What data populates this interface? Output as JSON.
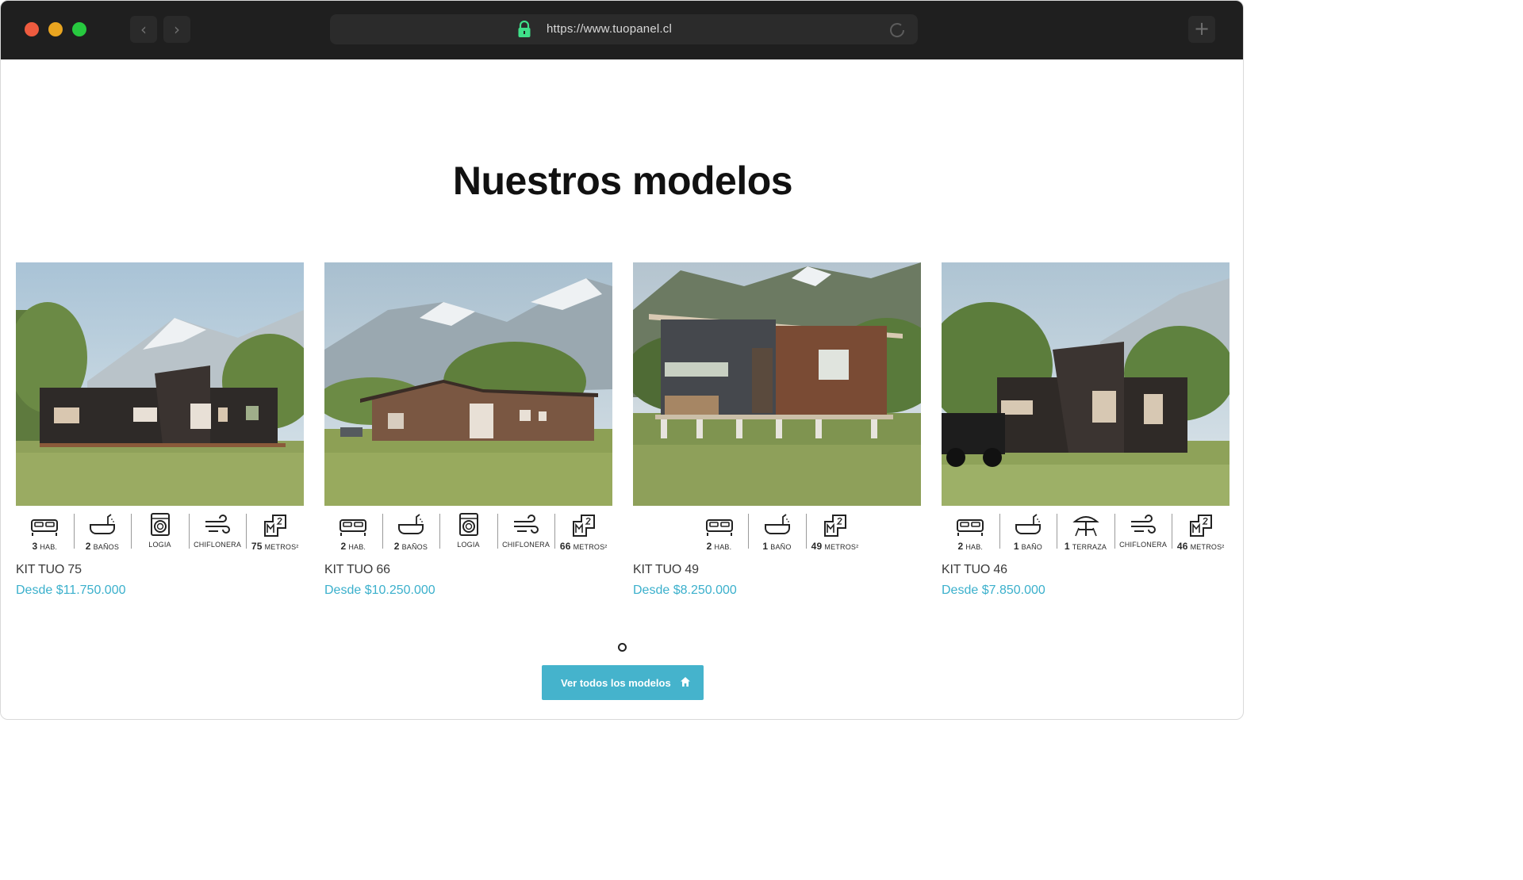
{
  "browser": {
    "url": "https://www.tuopanel.cl",
    "back_glyph": "‹",
    "forward_glyph": "›",
    "new_tab_glyph": "+"
  },
  "section": {
    "title": "Nuestros modelos"
  },
  "models": [
    {
      "name": "KIT TUO 75",
      "price": "Desde $11.750.000",
      "features": [
        {
          "icon": "bed-icon",
          "value": "3",
          "unit": "HAB."
        },
        {
          "icon": "bathtub-icon",
          "value": "2",
          "unit": "BAÑOS"
        },
        {
          "icon": "washing-machine-icon",
          "value": "",
          "unit": "LOGIA"
        },
        {
          "icon": "wind-icon",
          "value": "",
          "unit": "CHIFLONERA"
        },
        {
          "icon": "area-icon",
          "value": "75",
          "unit": "METROS²"
        }
      ]
    },
    {
      "name": "KIT TUO 66",
      "price": "Desde $10.250.000",
      "features": [
        {
          "icon": "bed-icon",
          "value": "2",
          "unit": "HAB."
        },
        {
          "icon": "bathtub-icon",
          "value": "2",
          "unit": "BAÑOS"
        },
        {
          "icon": "washing-machine-icon",
          "value": "",
          "unit": "LOGIA"
        },
        {
          "icon": "wind-icon",
          "value": "",
          "unit": "CHIFLONERA"
        },
        {
          "icon": "area-icon",
          "value": "66",
          "unit": "METROS²"
        }
      ]
    },
    {
      "name": "KIT TUO 49",
      "price": "Desde $8.250.000",
      "features": [
        {
          "icon": "bed-icon",
          "value": "2",
          "unit": "HAB."
        },
        {
          "icon": "bathtub-icon",
          "value": "1",
          "unit": "BAÑO"
        },
        {
          "icon": "area-icon",
          "value": "49",
          "unit": "METROS²"
        }
      ]
    },
    {
      "name": "KIT TUO 46",
      "price": "Desde $7.850.000",
      "features": [
        {
          "icon": "bed-icon",
          "value": "2",
          "unit": "HAB."
        },
        {
          "icon": "bathtub-icon",
          "value": "1",
          "unit": "BAÑO"
        },
        {
          "icon": "terrace-umbrella-icon",
          "value": "1",
          "unit": "TERRAZA"
        },
        {
          "icon": "wind-icon",
          "value": "",
          "unit": "CHIFLONERA"
        },
        {
          "icon": "area-icon",
          "value": "46",
          "unit": "METROS²"
        }
      ]
    }
  ],
  "cta": {
    "label": "Ver todos los modelos",
    "icon": "home-icon"
  },
  "colors": {
    "accent": "#45b3cc",
    "price": "#3bb0cc",
    "chrome": "#1f1f1f"
  }
}
